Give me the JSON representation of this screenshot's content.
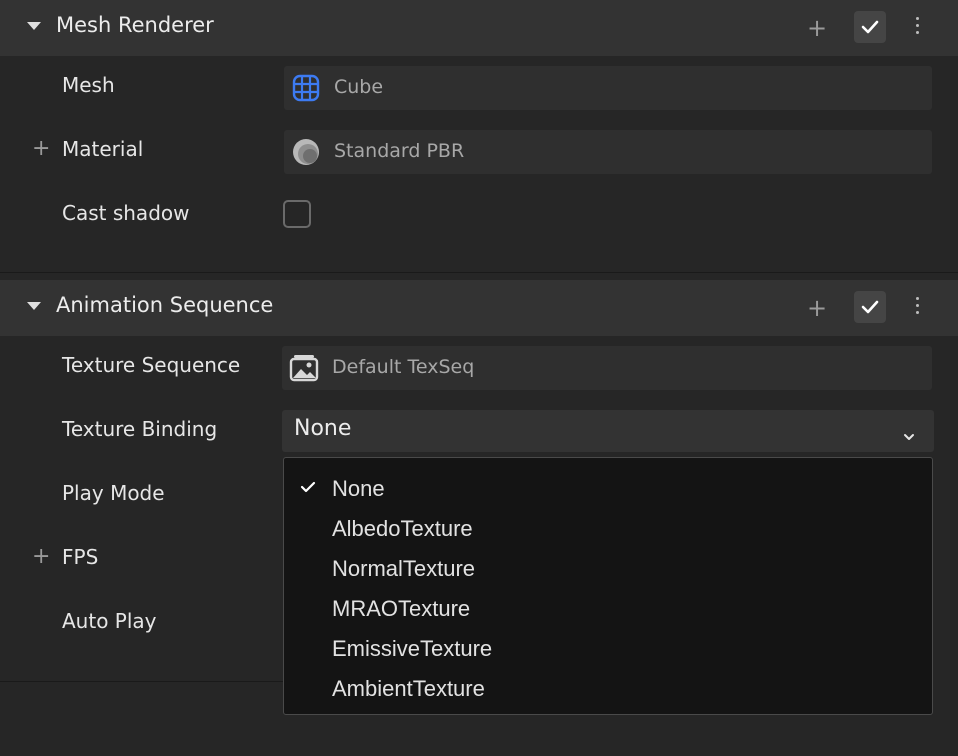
{
  "mesh_renderer": {
    "title": "Mesh Renderer",
    "add_icon": "plus-icon",
    "enabled_icon": "checkmark-icon",
    "menu_icon": "kebab-menu-icon",
    "mesh": {
      "label": "Mesh",
      "value": "Cube",
      "icon": "grid-mesh-icon"
    },
    "material": {
      "label": "Material",
      "value": "Standard PBR",
      "icon": "material-sphere-icon"
    },
    "cast_shadow": {
      "label": "Cast shadow",
      "checked": false
    }
  },
  "animation_sequence": {
    "title": "Animation Sequence",
    "texture_sequence": {
      "label": "Texture Sequence",
      "value": "Default TexSeq",
      "icon": "image-icon"
    },
    "texture_binding": {
      "label": "Texture Binding",
      "value": "None"
    },
    "play_mode": {
      "label": "Play Mode"
    },
    "fps": {
      "label": "FPS"
    },
    "auto_play": {
      "label": "Auto Play"
    }
  },
  "dropdown": {
    "selected": "None",
    "options": [
      "None",
      "AlbedoTexture",
      "NormalTexture",
      "MRAOTexture",
      "EmissiveTexture",
      "AmbientTexture"
    ]
  },
  "colors": {
    "background": "#262626",
    "header": "#333333",
    "accent_blue": "#3d7bf2",
    "dropdown_bg": "#141414"
  }
}
